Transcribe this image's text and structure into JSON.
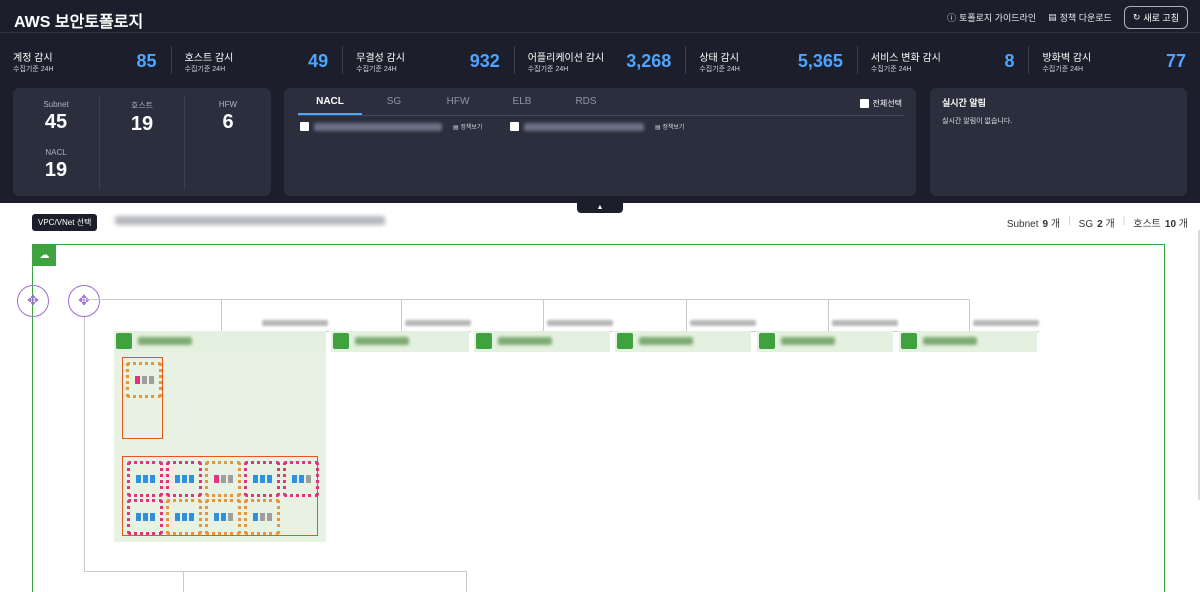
{
  "header": {
    "title": "AWS 보안토폴로지",
    "guide_label": "토폴로지 가이드라인",
    "download_label": "정책 다운로드",
    "refresh_label": "새로 고침"
  },
  "metrics": [
    {
      "label": "계정 감시",
      "sub": "수집기준 24H",
      "value": "85"
    },
    {
      "label": "호스트 감시",
      "sub": "수집기준 24H",
      "value": "49"
    },
    {
      "label": "무결성 감시",
      "sub": "수집기준 24H",
      "value": "932"
    },
    {
      "label": "어플리케이션 감시",
      "sub": "수집기준 24H",
      "value": "3,268"
    },
    {
      "label": "상태 감시",
      "sub": "수집기준 24H",
      "value": "5,365"
    },
    {
      "label": "서비스 변화 감시",
      "sub": "수집기준 24H",
      "value": "8"
    },
    {
      "label": "방화벽 감시",
      "sub": "수집기준 24H",
      "value": "77"
    }
  ],
  "counts": {
    "subnet_label": "Subnet",
    "subnet_value": "45",
    "host_label": "호스트",
    "host_value": "19",
    "hfw_label": "HFW",
    "hfw_value": "6",
    "nacl_label": "NACL",
    "nacl_value": "19"
  },
  "policy": {
    "tabs": [
      "NACL",
      "SG",
      "HFW",
      "ELB",
      "RDS"
    ],
    "active_tab": "NACL",
    "select_all_label": "전체선택",
    "view_label": "정책보기"
  },
  "alerts": {
    "title": "실시간 알림",
    "empty_message": "실시간 알림이 없습니다."
  },
  "topology": {
    "vpc_button_label": "VPC/VNet 선택",
    "summary": {
      "subnet_label": "Subnet",
      "subnet_value": "9",
      "subnet_unit": "개",
      "sg_label": "SG",
      "sg_value": "2",
      "sg_unit": "개",
      "host_label": "호스트",
      "host_value": "10",
      "host_unit": "개"
    }
  },
  "colors": {
    "accent": "#4ea4ff",
    "vpc_green": "#3ea33e",
    "router_purple": "#9f6bd6",
    "security_group": "#e2581f",
    "ec2_pink": "#e3337d",
    "ec2_orange": "#e8943a"
  }
}
